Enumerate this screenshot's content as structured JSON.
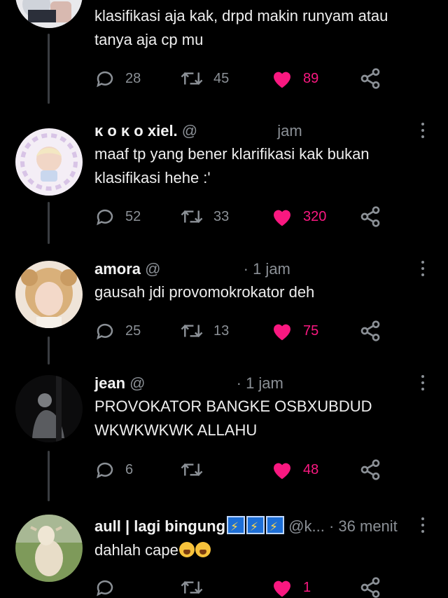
{
  "colors": {
    "background": "#000000",
    "text": "#eeeeee",
    "muted": "#8b9096",
    "like": "#f91880",
    "thread": "#3a3d41"
  },
  "tweets": [
    {
      "name": "",
      "handle": "",
      "time": "",
      "text": [
        "klasifikasi aja kak, drpd makin runyam atau",
        "tanya aja cp mu"
      ],
      "reply_count": "28",
      "retweet_count": "45",
      "like_count": "89",
      "liked": true
    },
    {
      "name": "κ ο κ ο xiel.",
      "handle": "@",
      "time": "jam",
      "text": [
        "maaf tp yang bener klarifikasi kak bukan",
        "klasifikasi hehe :'"
      ],
      "reply_count": "52",
      "retweet_count": "33",
      "like_count": "320",
      "liked": true
    },
    {
      "name": "amora",
      "handle": "@",
      "time": "· 1 jam",
      "text": [
        "gausah jdi provomokrokator deh"
      ],
      "reply_count": "25",
      "retweet_count": "13",
      "like_count": "75",
      "liked": true
    },
    {
      "name": "jean",
      "handle": "@",
      "time": "· 1 jam",
      "text": [
        "PROVOKATOR BANGKE OSBXUBDUD",
        "WKWKWKWK ALLAHU"
      ],
      "reply_count": "6",
      "retweet_count": "",
      "like_count": "48",
      "liked": true
    },
    {
      "name": "aull | lagi bingung",
      "handle": "@k...",
      "time": "· 36 menit",
      "text": [
        "dahlah cape"
      ],
      "reply_count": "",
      "retweet_count": "",
      "like_count": "1",
      "liked": true
    }
  ]
}
